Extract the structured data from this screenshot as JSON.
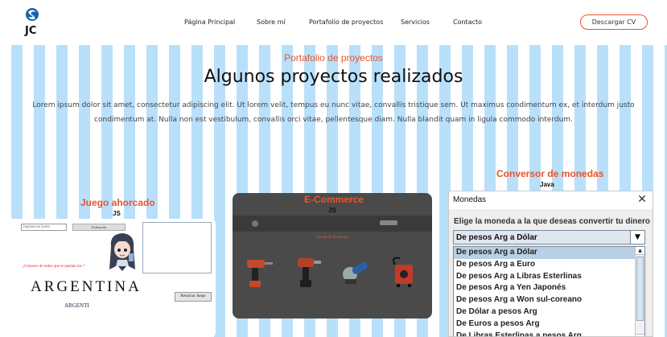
{
  "header": {
    "logo_text": "JC",
    "nav": [
      "Página Principal",
      "Sobre mí",
      "Portafolio de proyectos",
      "Servicios",
      "Contacto"
    ],
    "cv_button": "Descargar CV"
  },
  "portfolio": {
    "subtitle": "Portafolio de proyectos",
    "title": "Algunos proyectos realizados",
    "description": "Lorem ipsum dolor sit amet, consectetur adipiscing elit. Ut lorem velit, tempus eu nunc vitae, convallis tristique sem. Ut maximus condimentum ex, et interdum justo condimentum at. Nulla non est vestibulum, convallis orci vitae, pellentesque diam. Nulla blandit quam in ligula commodo interdum."
  },
  "projects": {
    "hangman": {
      "title": "Juego ahorcado",
      "tech": "JS",
      "input_placeholder": "Ingrese un Letra",
      "small_button": "Evaluación",
      "question": "¿Conoces de todos que te quedan los ?",
      "word": "ARGENTINA",
      "partial": "ARGENTI",
      "restart_button": "Reiniciar Juego"
    },
    "ecommerce": {
      "title": "E-Commerce",
      "tech": "JS",
      "store_heading": "Tienda de Productos"
    },
    "converter": {
      "title": "Conversor de monedas",
      "tech": "Java"
    }
  },
  "dialog": {
    "title": "Monedas",
    "close": "✕",
    "prompt": "Elige la moneda a la que deseas convertir tu dinero",
    "selected": "De pesos Arg a Dólar",
    "options": [
      "De pesos Arg a Dólar",
      "De pesos Arg a Euro",
      "De pesos Arg a Libras Esterlinas",
      "De pesos Arg a Yen Japonés",
      "De pesos Arg a Won sul-coreano",
      "De Dólar a pesos Arg",
      "De Euros a pesos Arg",
      "De Libras Esterlinas a pesos Arg"
    ],
    "combo_arrow": "▼",
    "scroll_up": "▲",
    "scroll_down": "▼"
  },
  "colors": {
    "accent": "#e8542c",
    "stripe": "#b9e0fb"
  }
}
